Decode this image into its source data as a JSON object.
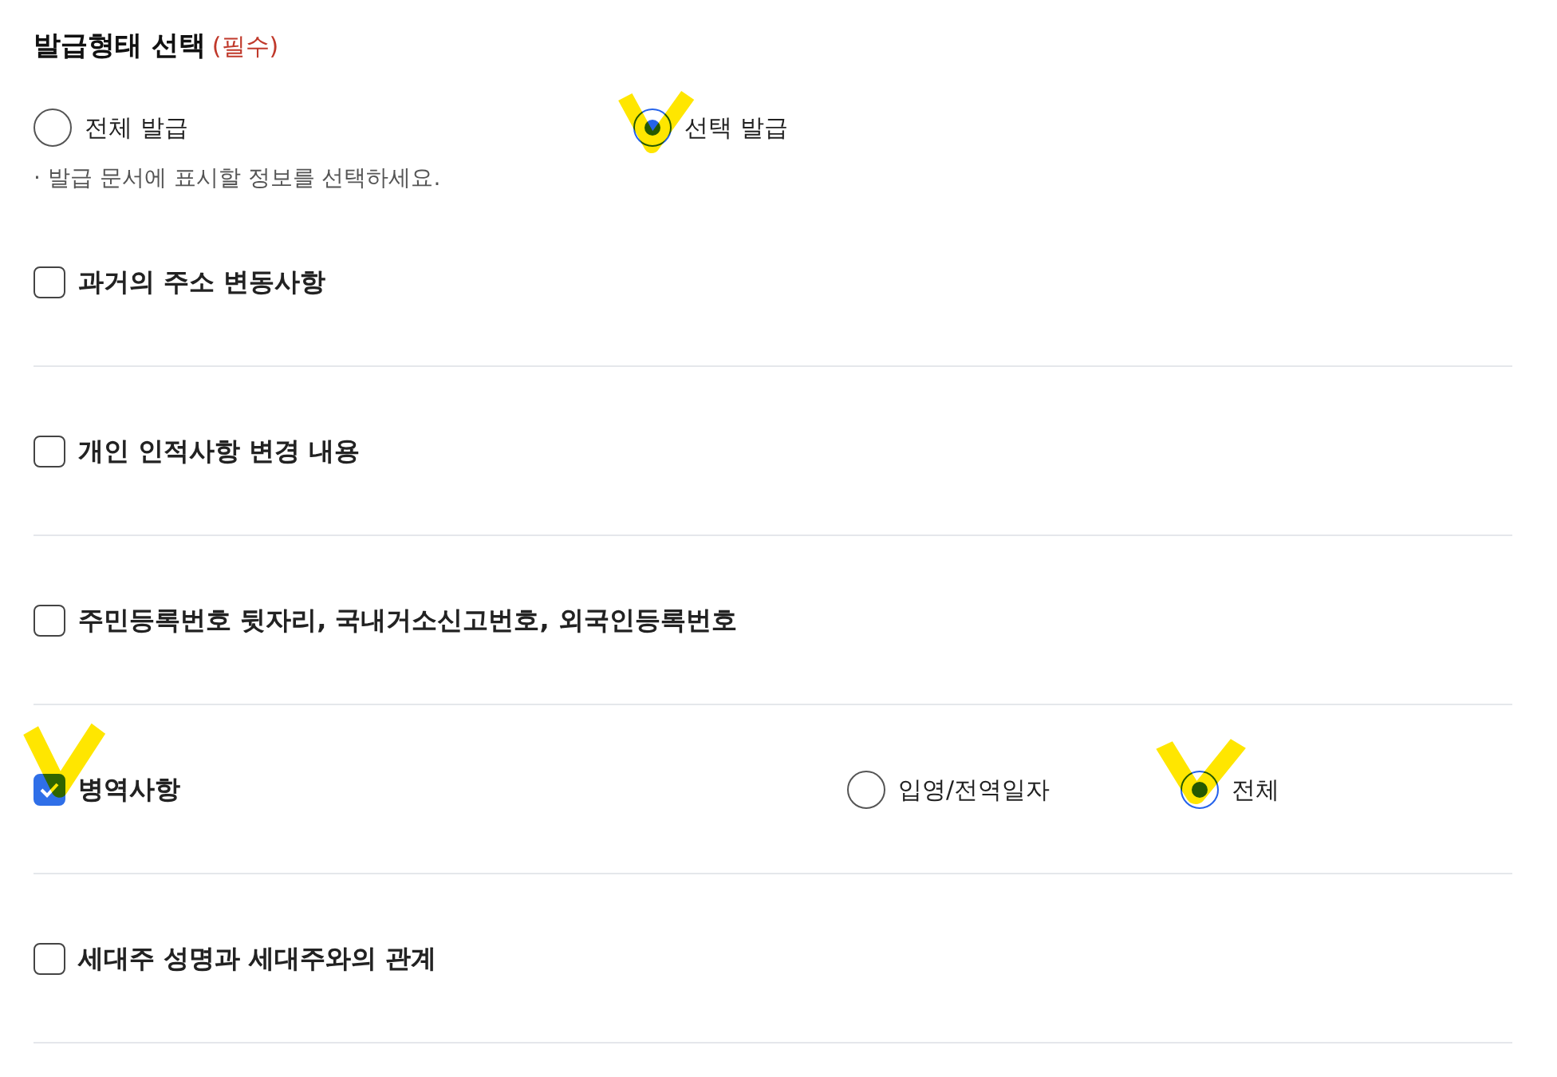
{
  "section": {
    "title": "발급형태 선택",
    "required": "(필수)"
  },
  "issue_types": [
    {
      "label": "전체 발급",
      "selected": false
    },
    {
      "label": "선택 발급",
      "selected": true
    }
  ],
  "note": "· 발급 문서에 표시할 정보를 선택하세요.",
  "items": [
    {
      "label": "과거의 주소 변동사항",
      "checked": false
    },
    {
      "label": "개인 인적사항 변경 내용",
      "checked": false
    },
    {
      "label": "주민등록번호 뒷자리, 국내거소신고번호, 외국인등록번호",
      "checked": false
    },
    {
      "label": "병역사항",
      "checked": true,
      "options": [
        {
          "label": "입영/전역일자",
          "selected": false
        },
        {
          "label": "전체",
          "selected": true
        }
      ]
    },
    {
      "label": "세대주 성명과 세대주와의 관계",
      "checked": false
    }
  ]
}
